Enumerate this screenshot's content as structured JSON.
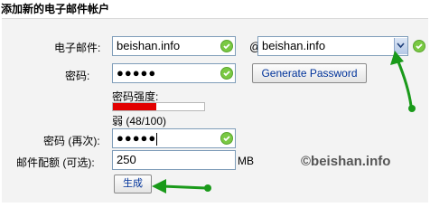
{
  "title": "添加新的电子邮件帐户",
  "email": {
    "label": "电子邮件:",
    "value": "beishan.info",
    "at": "@",
    "domain_selected": "beishan.info"
  },
  "password": {
    "label": "密码:",
    "dots": "●●●●●",
    "generate_label": "Generate Password"
  },
  "strength": {
    "label": "密码强度:",
    "text": "弱 (48/100)",
    "value": 48,
    "max": 100,
    "color": "#e20000"
  },
  "password_again": {
    "label": "密码 (再次):",
    "dots": "●●●●●"
  },
  "quota": {
    "label": "邮件配额 (可选):",
    "value": "250",
    "unit": "MB"
  },
  "submit_label": "生成",
  "watermark": "©beishan.info",
  "colors": {
    "accent": "#00339a",
    "check": "#7ac943",
    "arrow": "#1a9a1a",
    "weak": "#e20000"
  }
}
